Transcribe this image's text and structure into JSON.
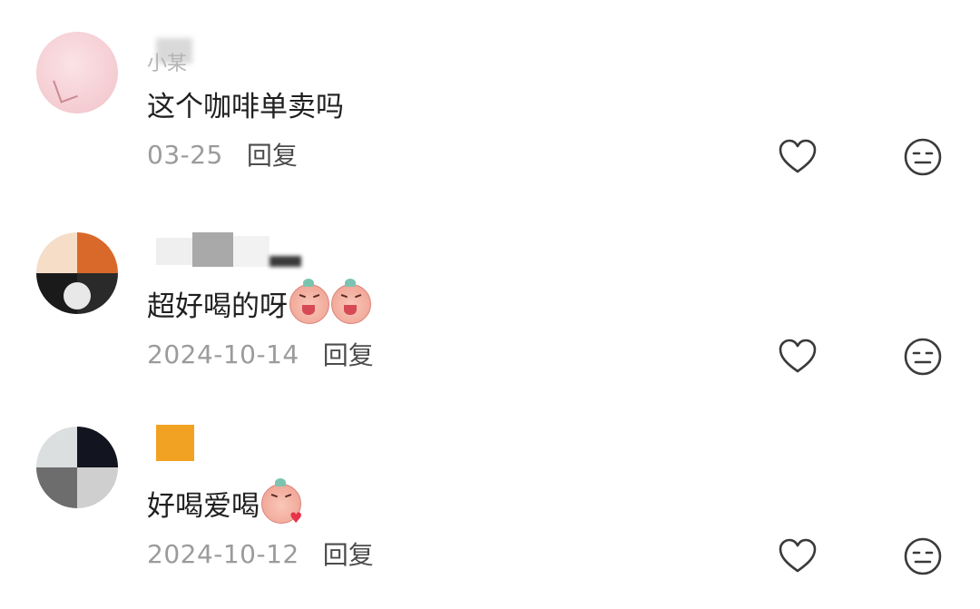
{
  "comments": [
    {
      "username": "小某",
      "text": "这个咖啡单卖吗",
      "emojis": [],
      "date": "03-25",
      "reply_label": "回复"
    },
    {
      "username": "",
      "text": "超好喝的呀",
      "emojis": [
        "laughing-pig-emoji",
        "laughing-pig-emoji"
      ],
      "date": "2024-10-14",
      "reply_label": "回复"
    },
    {
      "username": "",
      "text": "好喝爱喝",
      "emojis": [
        "kiss-pig-emoji"
      ],
      "date": "2024-10-12",
      "reply_label": "回复"
    }
  ],
  "icons": {
    "like": "heart-outline-icon",
    "dislike": "neutral-face-icon"
  },
  "colors": {
    "text": "#1f1f1f",
    "date": "#9b9b9b",
    "reply": "#4c4c4c",
    "icon_stroke": "#3a3a3a"
  }
}
